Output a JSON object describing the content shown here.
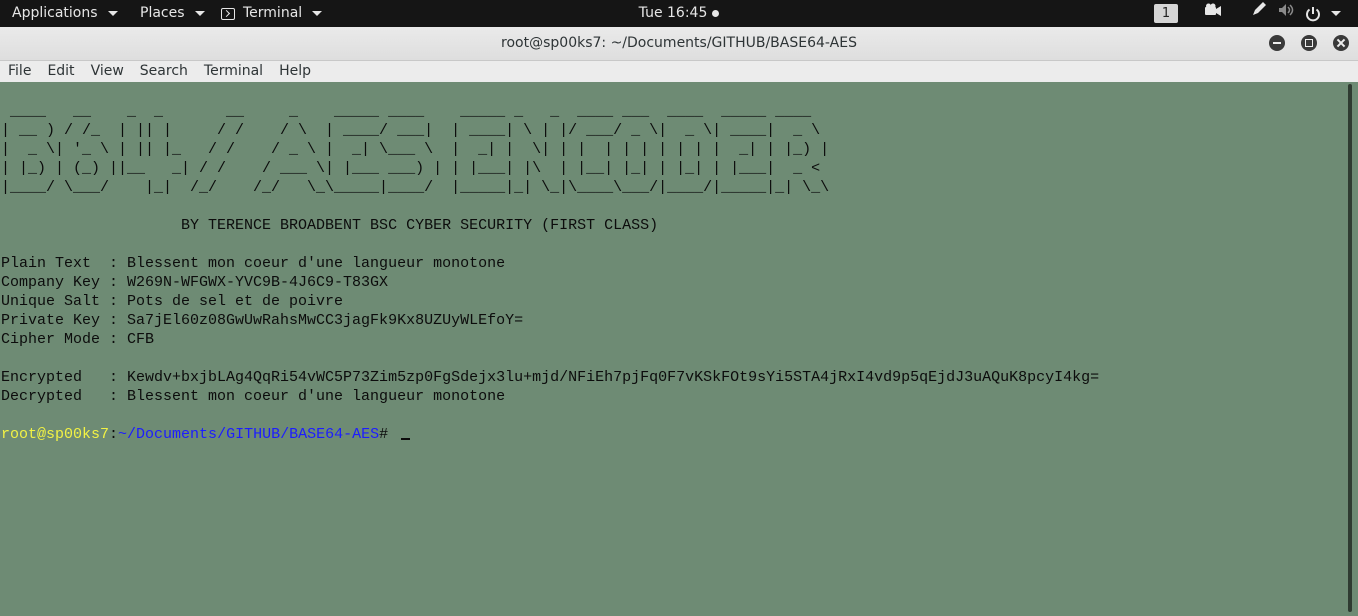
{
  "topbar": {
    "applications": "Applications",
    "places": "Places",
    "terminal": "Terminal",
    "clock": "Tue 16:45",
    "workspace": "1",
    "icons": [
      "camera-icon",
      "pen-icon",
      "volume-icon",
      "power-icon"
    ]
  },
  "window": {
    "title": "root@sp00ks7: ~/Documents/GITHUB/BASE64-AES"
  },
  "menu": [
    "File",
    "Edit",
    "View",
    "Search",
    "Terminal",
    "Help"
  ],
  "terminal": {
    "banner": [
      " ____   __    _  _       __     _    _____ ____    _____ _   _  ____ ___  ____  _____ ____  ",
      "| __ ) / /_  | || |     / /    / \\  | ____/ ___|  | ____| \\ | |/ ___/ _ \\|  _ \\| ____|  _ \\ ",
      "|  _ \\| '_ \\ | || |_   / /    / _ \\ |  _| \\___ \\  |  _| |  \\| | |  | | | | | | |  _| | |_) |",
      "| |_) | (_) ||__   _| / /    / ___ \\| |___ ___) | | |___| |\\  | |__| |_| | |_| | |___|  _ < ",
      "|____/ \\___/    |_|  /_/    /_/   \\_\\_____|____/  |_____|_| \\_|\\____\\___/|____/|_____|_| \\_\\"
    ],
    "author": "                    BY TERENCE BROADBENT BSC CYBER SECURITY (FIRST CLASS)",
    "plain_text": "Plain Text  : Blessent mon coeur d'une langueur monotone",
    "company_key": "Company Key : W269N-WFGWX-YVC9B-4J6C9-T83GX",
    "unique_salt": "Unique Salt : Pots de sel et de poivre",
    "private_key": "Private Key : Sa7jEl60z08GwUwRahsMwCC3jagFk9Kx8UZUyWLEfoY=",
    "cipher_mode": "Cipher Mode : CFB",
    "encrypted": "Encrypted   : Kewdv+bxjbLAg4QqRi54vWC5P73Zim5zp0FgSdejx3lu+mjd/NFiEh7pjFq0F7vKSkFOt9sYi5STA4jRxI4vd9p5qEjdJ3uAQuK8pcyI4kg=",
    "decrypted": "Decrypted   : Blessent mon coeur d'une langueur monotone",
    "prompt_user": "root@sp00ks7",
    "prompt_sep": ":",
    "prompt_path": "~/Documents/GITHUB/BASE64-AES",
    "prompt_symbol": "# "
  }
}
